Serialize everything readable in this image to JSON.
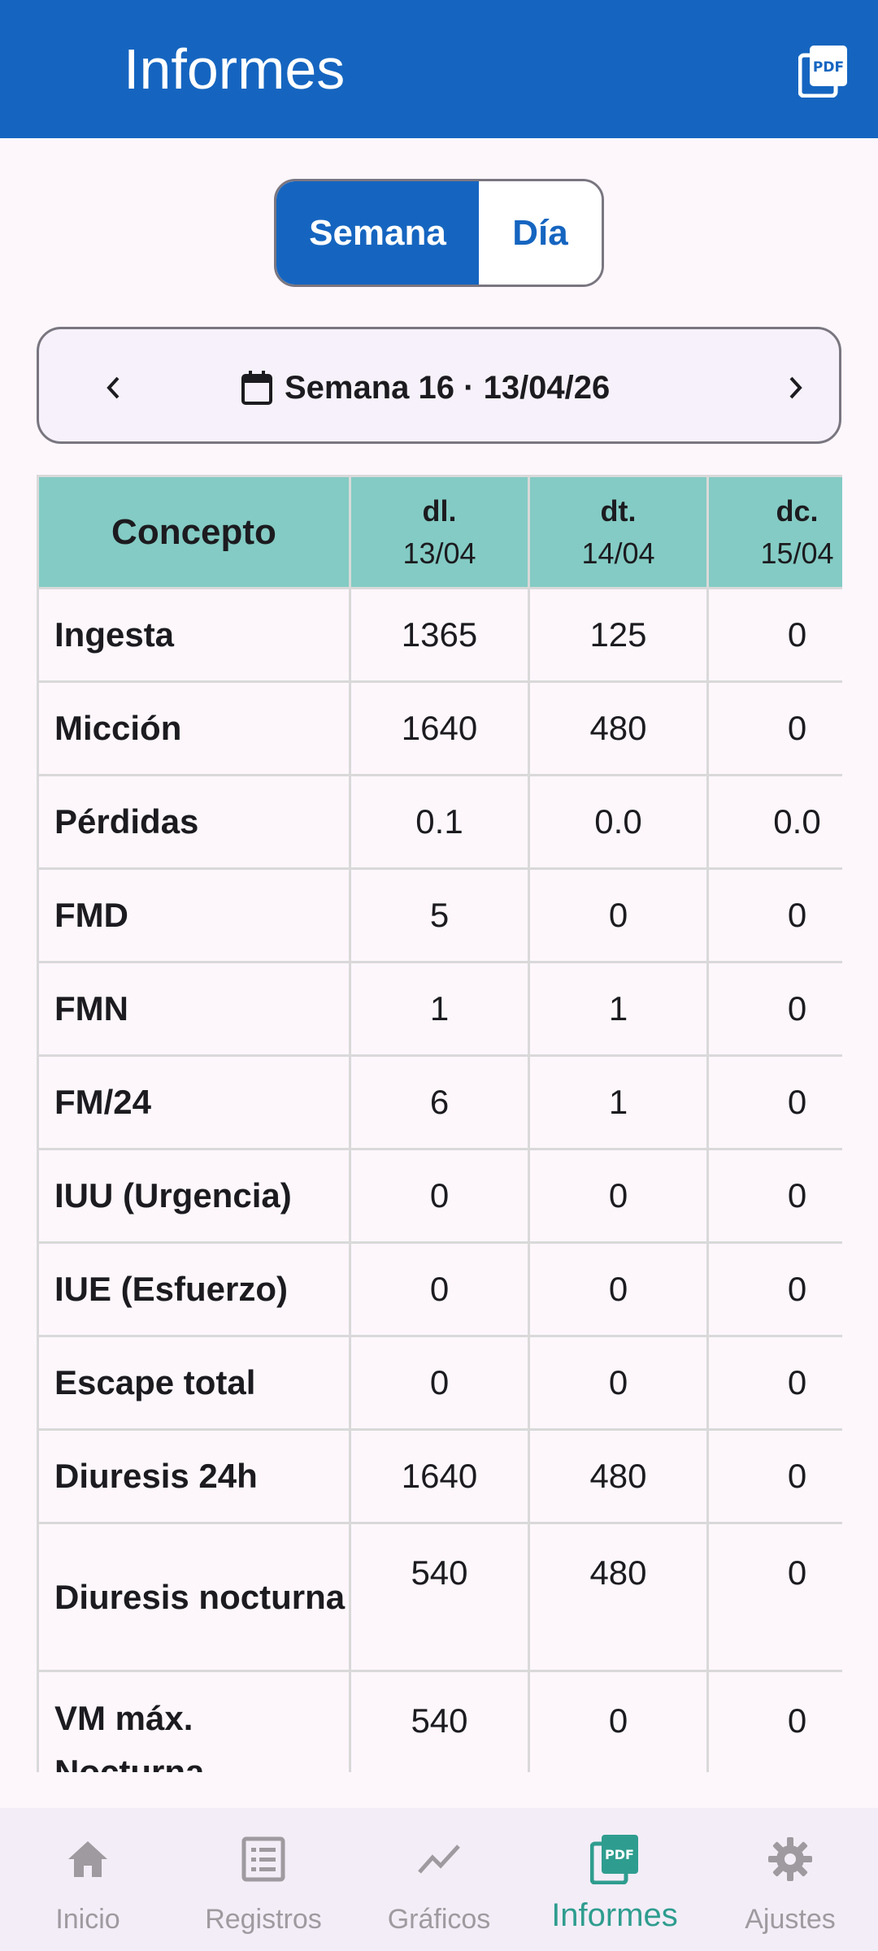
{
  "appbar": {
    "title": "Informes",
    "action_icon": "pdf-icon"
  },
  "segment": {
    "options": [
      "Semana",
      "Día"
    ],
    "selected": "Semana"
  },
  "week_nav": {
    "label": "Semana 16 · 13/04/26"
  },
  "table": {
    "header": {
      "concept": "Concepto",
      "days": [
        {
          "day": "dl.",
          "date": "13/04"
        },
        {
          "day": "dt.",
          "date": "14/04"
        },
        {
          "day": "dc.",
          "date": "15/04"
        }
      ]
    },
    "rows": [
      {
        "label": "Ingesta",
        "values": [
          "1365",
          "125",
          "0"
        ]
      },
      {
        "label": "Micción",
        "values": [
          "1640",
          "480",
          "0"
        ]
      },
      {
        "label": "Pérdidas",
        "values": [
          "0.1",
          "0.0",
          "0.0"
        ]
      },
      {
        "label": "FMD",
        "values": [
          "5",
          "0",
          "0"
        ]
      },
      {
        "label": "FMN",
        "values": [
          "1",
          "1",
          "0"
        ]
      },
      {
        "label": "FM/24",
        "values": [
          "6",
          "1",
          "0"
        ]
      },
      {
        "label": "IUU (Urgencia)",
        "values": [
          "0",
          "0",
          "0"
        ]
      },
      {
        "label": "IUE (Esfuerzo)",
        "values": [
          "0",
          "0",
          "0"
        ]
      },
      {
        "label": "Escape total",
        "values": [
          "0",
          "0",
          "0"
        ]
      },
      {
        "label": "Diuresis 24h",
        "values": [
          "1640",
          "480",
          "0"
        ]
      },
      {
        "label": "Diuresis nocturna",
        "values": [
          "540",
          "480",
          "0"
        ]
      },
      {
        "label": "VM máx. Nocturna",
        "values": [
          "540",
          "0",
          "0"
        ]
      }
    ]
  },
  "bottom_nav": {
    "items": [
      {
        "label": "Inicio",
        "icon": "home-icon"
      },
      {
        "label": "Registros",
        "icon": "list-icon"
      },
      {
        "label": "Gráficos",
        "icon": "chart-line-icon"
      },
      {
        "label": "Informes",
        "icon": "pdf-icon"
      },
      {
        "label": "Ajustes",
        "icon": "gear-icon"
      }
    ],
    "active": "Informes"
  },
  "colors": {
    "primary": "#1565c0",
    "header_teal": "#83cbc4",
    "active_nav": "#2e9d8f",
    "background": "#fdf7fc"
  }
}
